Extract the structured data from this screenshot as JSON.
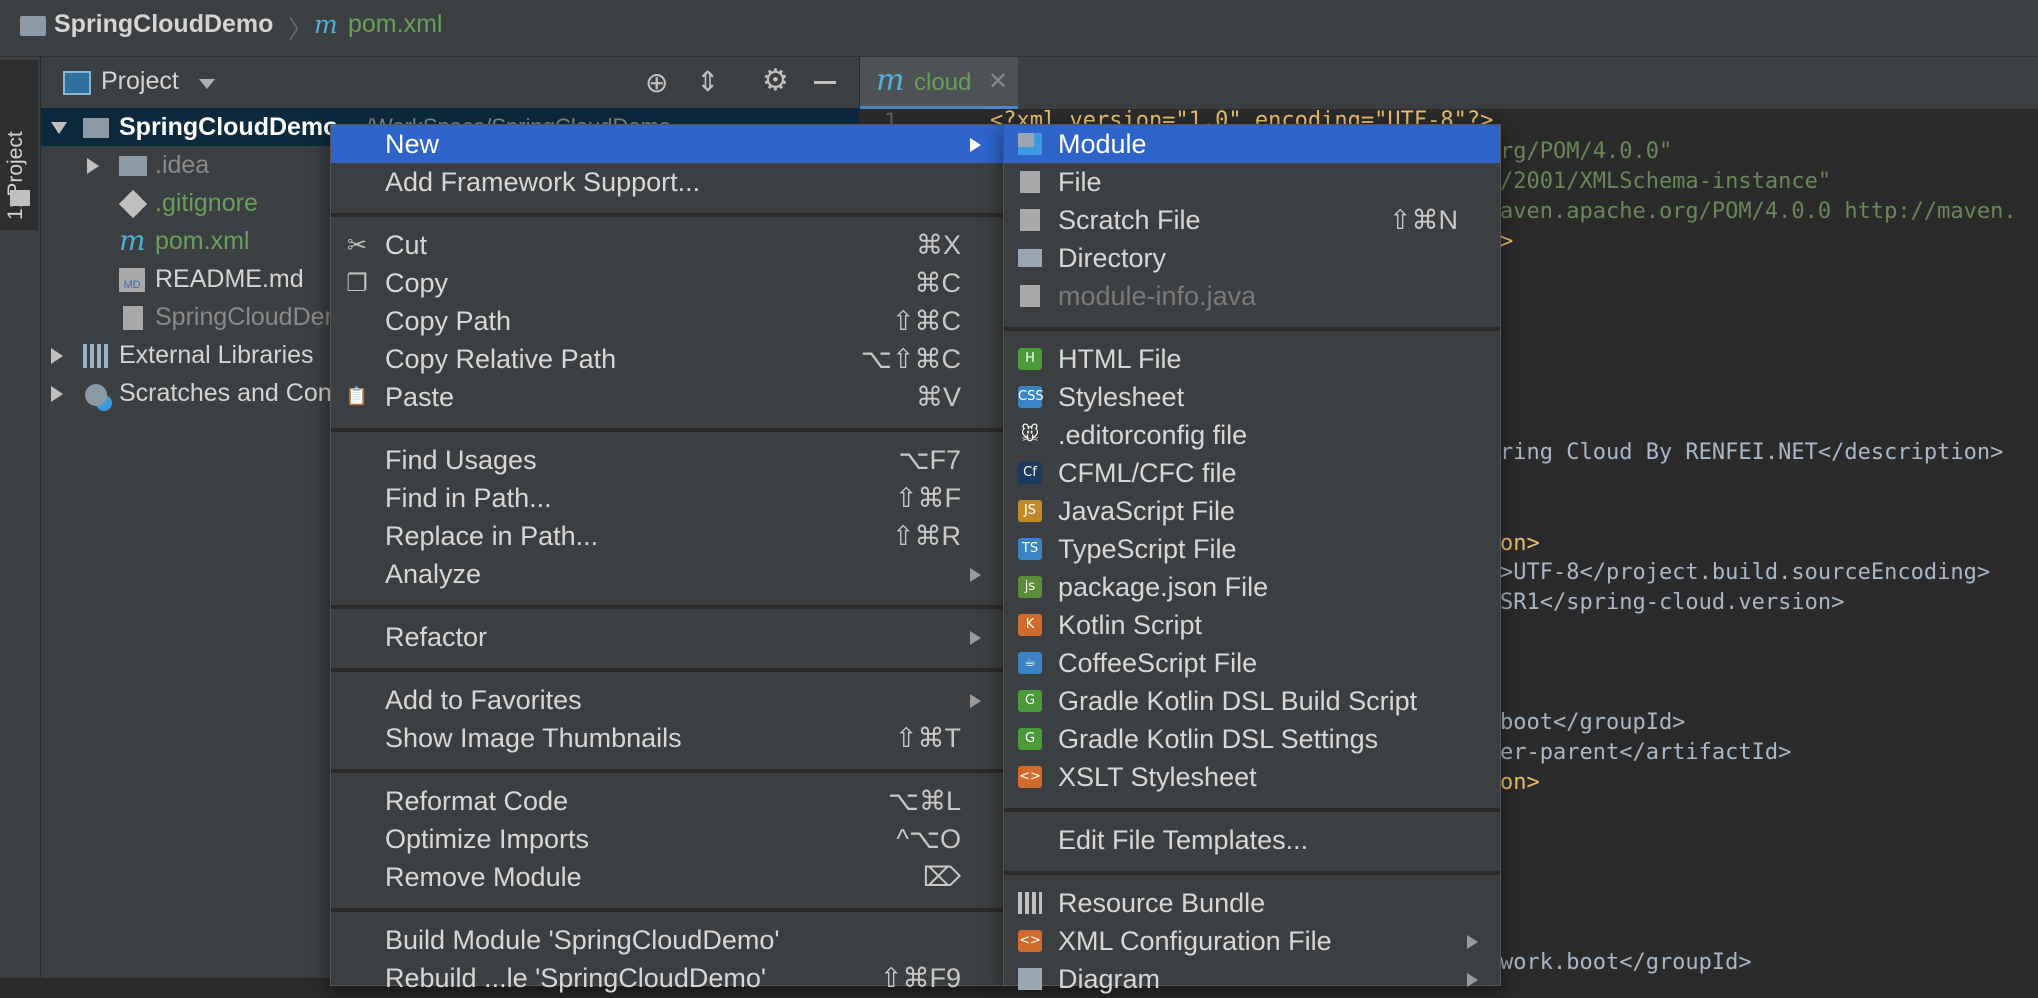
{
  "navbar": {
    "project_crumb": "SpringCloudDemo",
    "file_crumb": "pom.xml"
  },
  "toolwindow": {
    "project_tab": "1: Project"
  },
  "project_panel": {
    "header_label": "Project",
    "tree": [
      {
        "label": "SpringCloudDemo",
        "suffix": "~/WorkSpace/SpringCloudDemo",
        "type": "root"
      },
      {
        "label": ".idea",
        "type": "folder"
      },
      {
        "label": ".gitignore",
        "type": "git"
      },
      {
        "label": "pom.xml",
        "type": "maven"
      },
      {
        "label": "README.md",
        "type": "md"
      },
      {
        "label": "SpringCloudDemo.iml",
        "type": "iml"
      },
      {
        "label": "External Libraries",
        "type": "libs"
      },
      {
        "label": "Scratches and Consoles",
        "type": "scratch"
      }
    ]
  },
  "editor": {
    "tab_label": "cloud",
    "line_number": "1",
    "code": [
      {
        "text": "<?xml version=\"1.0\" encoding=\"UTF-8\"?>",
        "kind": "tag"
      },
      {
        "text": "rg/POM/4.0.0\"",
        "kind": "str"
      },
      {
        "text": "/2001/XMLSchema-instance\"",
        "kind": "str"
      },
      {
        "text": "aven.apache.org/POM/4.0.0 http://maven.",
        "kind": "str"
      },
      {
        "text": ">",
        "kind": "tag"
      },
      {
        "text": "ring Cloud By RENFEI.NET</description>",
        "kind": "mixed"
      },
      {
        "text": "on>",
        "kind": "tag"
      },
      {
        "text": ">UTF-8</project.build.sourceEncoding>",
        "kind": "mixed"
      },
      {
        "text": "SR1</spring-cloud.version>",
        "kind": "mixed"
      },
      {
        "text": "boot</groupId>",
        "kind": "mixed"
      },
      {
        "text": "er-parent</artifactId>",
        "kind": "mixed"
      },
      {
        "text": "on>",
        "kind": "tag"
      },
      {
        "text": "work.boot</groupId>",
        "kind": "mixed"
      }
    ]
  },
  "context_menu": {
    "items": [
      {
        "label": "New",
        "shortcut": "",
        "submenu": true,
        "selected": true,
        "icon": ""
      },
      {
        "label": "Add Framework Support...",
        "shortcut": "",
        "icon": ""
      },
      {
        "sep": true
      },
      {
        "label": "Cut",
        "shortcut": "⌘X",
        "icon": "scissors-icon"
      },
      {
        "label": "Copy",
        "shortcut": "⌘C",
        "icon": "copy-icon"
      },
      {
        "label": "Copy Path",
        "shortcut": "⇧⌘C",
        "icon": ""
      },
      {
        "label": "Copy Relative Path",
        "shortcut": "⌥⇧⌘C",
        "icon": ""
      },
      {
        "label": "Paste",
        "shortcut": "⌘V",
        "icon": "paste-icon"
      },
      {
        "sep": true
      },
      {
        "label": "Find Usages",
        "shortcut": "⌥F7",
        "icon": ""
      },
      {
        "label": "Find in Path...",
        "shortcut": "⇧⌘F",
        "icon": ""
      },
      {
        "label": "Replace in Path...",
        "shortcut": "⇧⌘R",
        "icon": ""
      },
      {
        "label": "Analyze",
        "shortcut": "",
        "submenu": true,
        "icon": ""
      },
      {
        "sep": true
      },
      {
        "label": "Refactor",
        "shortcut": "",
        "submenu": true,
        "icon": ""
      },
      {
        "sep": true
      },
      {
        "label": "Add to Favorites",
        "shortcut": "",
        "submenu": true,
        "icon": ""
      },
      {
        "label": "Show Image Thumbnails",
        "shortcut": "⇧⌘T",
        "icon": ""
      },
      {
        "sep": true
      },
      {
        "label": "Reformat Code",
        "shortcut": "⌥⌘L",
        "icon": ""
      },
      {
        "label": "Optimize Imports",
        "shortcut": "^⌥O",
        "icon": ""
      },
      {
        "label": "Remove Module",
        "shortcut": "⌦",
        "icon": ""
      },
      {
        "sep": true
      },
      {
        "label": "Build Module 'SpringCloudDemo'",
        "shortcut": "",
        "icon": ""
      },
      {
        "label": "Rebuild ...le 'SpringCloudDemo'",
        "shortcut": "⇧⌘F9",
        "icon": ""
      }
    ]
  },
  "new_submenu": {
    "items": [
      {
        "label": "Module",
        "shortcut": "",
        "icon": "module-icon",
        "selected": true
      },
      {
        "label": "File",
        "shortcut": "",
        "icon": "file-icon"
      },
      {
        "label": "Scratch File",
        "shortcut": "⇧⌘N",
        "icon": "scratch-file-icon"
      },
      {
        "label": "Directory",
        "shortcut": "",
        "icon": "folder-icon"
      },
      {
        "label": "module-info.java",
        "shortcut": "",
        "icon": "java-file-icon",
        "disabled": true
      },
      {
        "sep": true
      },
      {
        "label": "HTML File",
        "shortcut": "",
        "icon": "html-file-icon",
        "badge": "H",
        "color": "#4a9a3a"
      },
      {
        "label": "Stylesheet",
        "shortcut": "",
        "icon": "css-file-icon",
        "badge": "CSS",
        "color": "#3a84c6"
      },
      {
        "label": ".editorconfig file",
        "shortcut": "",
        "icon": "editorconfig-icon"
      },
      {
        "label": "CFML/CFC file",
        "shortcut": "",
        "icon": "cfml-icon",
        "badge": "Cf",
        "color": "#1c3a5e"
      },
      {
        "label": "JavaScript File",
        "shortcut": "",
        "icon": "js-file-icon",
        "badge": "JS",
        "color": "#c08a2a"
      },
      {
        "label": "TypeScript File",
        "shortcut": "",
        "icon": "ts-file-icon",
        "badge": "TS",
        "color": "#3a84c6"
      },
      {
        "label": "package.json File",
        "shortcut": "",
        "icon": "nodejs-icon",
        "badge": "js",
        "color": "#5b8c3a"
      },
      {
        "label": "Kotlin Script",
        "shortcut": "",
        "icon": "kotlin-icon",
        "badge": "K",
        "color": "#d06b2c"
      },
      {
        "label": "CoffeeScript File",
        "shortcut": "",
        "icon": "coffeescript-icon",
        "badge": "☕",
        "color": "#3a84c6"
      },
      {
        "label": "Gradle Kotlin DSL Build Script",
        "shortcut": "",
        "icon": "gradle-icon",
        "badge": "G",
        "color": "#4a9a3a"
      },
      {
        "label": "Gradle Kotlin DSL Settings",
        "shortcut": "",
        "icon": "gradle-icon",
        "badge": "G",
        "color": "#4a9a3a"
      },
      {
        "label": "XSLT Stylesheet",
        "shortcut": "",
        "icon": "xslt-icon",
        "badge": "<>",
        "color": "#d06b2c"
      },
      {
        "sep": true
      },
      {
        "label": "Edit File Templates...",
        "shortcut": "",
        "icon": ""
      },
      {
        "sep": true
      },
      {
        "label": "Resource Bundle",
        "shortcut": "",
        "icon": "resource-bundle-icon"
      },
      {
        "label": "XML Configuration File",
        "shortcut": "",
        "icon": "xml-config-icon",
        "submenu": true,
        "badge": "<>",
        "color": "#d06b2c"
      },
      {
        "label": "Diagram",
        "shortcut": "",
        "icon": "diagram-icon",
        "submenu": true
      }
    ]
  }
}
